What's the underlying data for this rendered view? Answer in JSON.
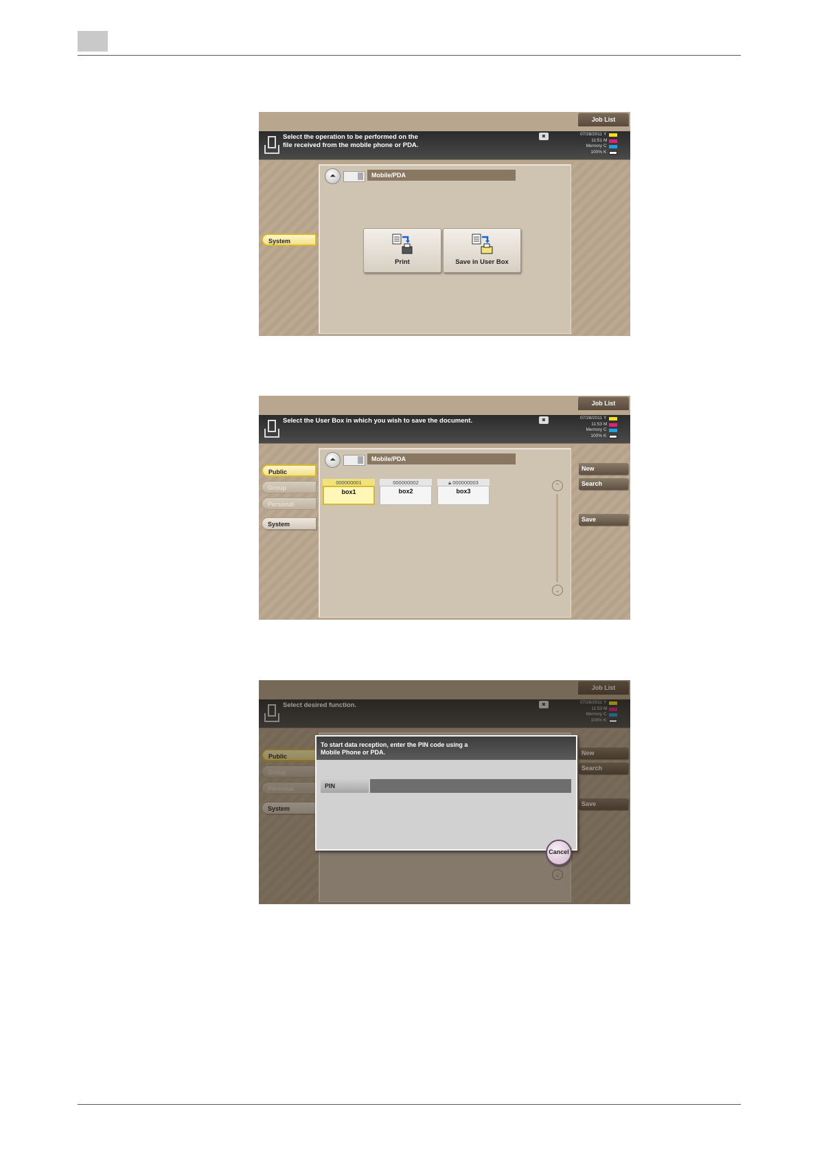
{
  "screens": [
    {
      "job_list": "Job List",
      "message": "Select the operation to be performed on the\nfile received from the mobile phone or PDA.",
      "status": {
        "date": "07/28/2011",
        "time": "11:51",
        "memory_label": "Memory",
        "memory_value": "100%"
      },
      "toner": [
        {
          "label": "Y",
          "color": "#f0e020"
        },
        {
          "label": "M",
          "color": "#e0207a"
        },
        {
          "label": "C",
          "color": "#20a0e0"
        },
        {
          "label": "K",
          "color": "#222222"
        }
      ],
      "up_icon": "up-arrow-icon",
      "path": "Mobile/PDA",
      "left_tabs": [
        "System"
      ],
      "buttons": [
        {
          "label": "Print",
          "icon": "print-icon"
        },
        {
          "label": "Save in User Box",
          "icon": "save-in-user-box-icon"
        }
      ]
    },
    {
      "job_list": "Job List",
      "message": "Select the User Box in which you wish to save the document.",
      "status": {
        "date": "07/28/2011",
        "time": "11:53",
        "memory_label": "Memory",
        "memory_value": "100%"
      },
      "toner": [
        {
          "label": "Y",
          "color": "#f0e020"
        },
        {
          "label": "M",
          "color": "#e0207a"
        },
        {
          "label": "C",
          "color": "#20a0e0"
        },
        {
          "label": "K",
          "color": "#222222"
        }
      ],
      "path": "Mobile/PDA",
      "left_tabs": [
        "Public",
        "Group",
        "Personal",
        "System"
      ],
      "boxes": [
        {
          "number": "000000001",
          "name": "box1"
        },
        {
          "number": "000000002",
          "name": "box2"
        },
        {
          "number": "000000003",
          "name": "box3"
        }
      ],
      "right_buttons": [
        "New",
        "Search",
        "Save"
      ]
    },
    {
      "job_list": "Job List",
      "message": "Select desired function.",
      "status": {
        "date": "07/28/2011",
        "time": "11:53",
        "memory_label": "Memory",
        "memory_value": "100%"
      },
      "toner": [
        {
          "label": "Y",
          "color": "#f0e020"
        },
        {
          "label": "M",
          "color": "#e0207a"
        },
        {
          "label": "C",
          "color": "#20a0e0"
        },
        {
          "label": "K",
          "color": "#222222"
        }
      ],
      "left_tabs": [
        "Public",
        "Group",
        "Personal",
        "System"
      ],
      "right_buttons": [
        "New",
        "Search",
        "Save"
      ],
      "dialog": {
        "message": "To start data reception, enter the PIN code using a\nMobile Phone or PDA.",
        "pin_label": "PIN",
        "cancel": "Cancel"
      }
    }
  ]
}
